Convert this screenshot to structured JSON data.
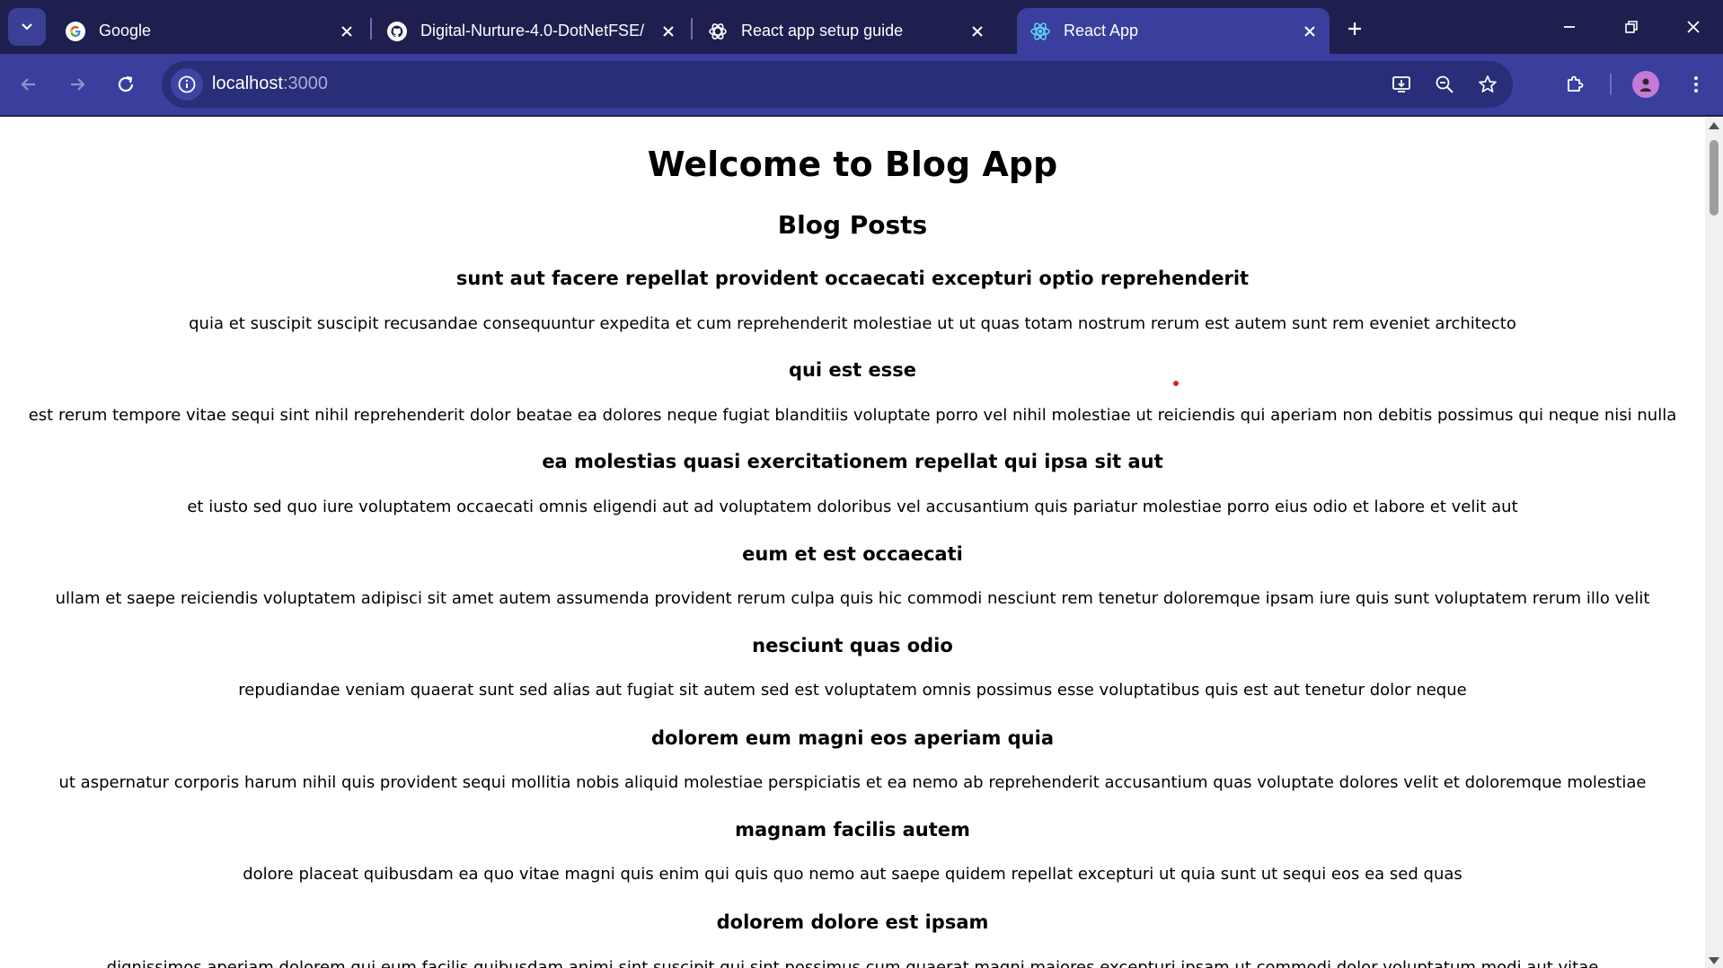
{
  "browser": {
    "tabs": [
      {
        "title": "Google",
        "icon": "google-icon"
      },
      {
        "title": "Digital-Nurture-4.0-DotNetFSE/",
        "icon": "github-icon"
      },
      {
        "title": "React app setup guide",
        "icon": "chatgpt-icon"
      },
      {
        "title": "React App",
        "icon": "react-icon"
      }
    ],
    "url_host": "localhost",
    "url_port": ":3000"
  },
  "page": {
    "heading": "Welcome to Blog App",
    "subheading": "Blog Posts",
    "posts": [
      {
        "title": "sunt aut facere repellat provident occaecati excepturi optio reprehenderit",
        "body": "quia et suscipit suscipit recusandae consequuntur expedita et cum reprehenderit molestiae ut ut quas totam nostrum rerum est autem sunt rem eveniet architecto"
      },
      {
        "title": "qui est esse",
        "body": "est rerum tempore vitae sequi sint nihil reprehenderit dolor beatae ea dolores neque fugiat blanditiis voluptate porro vel nihil molestiae ut reiciendis qui aperiam non debitis possimus qui neque nisi nulla"
      },
      {
        "title": "ea molestias quasi exercitationem repellat qui ipsa sit aut",
        "body": "et iusto sed quo iure voluptatem occaecati omnis eligendi aut ad voluptatem doloribus vel accusantium quis pariatur molestiae porro eius odio et labore et velit aut"
      },
      {
        "title": "eum et est occaecati",
        "body": "ullam et saepe reiciendis voluptatem adipisci sit amet autem assumenda provident rerum culpa quis hic commodi nesciunt rem tenetur doloremque ipsam iure quis sunt voluptatem rerum illo velit"
      },
      {
        "title": "nesciunt quas odio",
        "body": "repudiandae veniam quaerat sunt sed alias aut fugiat sit autem sed est voluptatem omnis possimus esse voluptatibus quis est aut tenetur dolor neque"
      },
      {
        "title": "dolorem eum magni eos aperiam quia",
        "body": "ut aspernatur corporis harum nihil quis provident sequi mollitia nobis aliquid molestiae perspiciatis et ea nemo ab reprehenderit accusantium quas voluptate dolores velit et doloremque molestiae"
      },
      {
        "title": "magnam facilis autem",
        "body": "dolore placeat quibusdam ea quo vitae magni quis enim qui quis quo nemo aut saepe quidem repellat excepturi ut quia sunt ut sequi eos ea sed quas"
      },
      {
        "title": "dolorem dolore est ipsam",
        "body": "dignissimos aperiam dolorem qui eum facilis quibusdam animi sint suscipit qui sint possimus cum quaerat magni maiores excepturi ipsam ut commodi dolor voluptatum modi aut vitae"
      }
    ]
  },
  "colors": {
    "tabbar_bg": "#1e1f4f",
    "toolbar_bg": "#3a3f9e",
    "omnibox_bg": "#2a2d78",
    "page_bg": "#ffffff"
  }
}
